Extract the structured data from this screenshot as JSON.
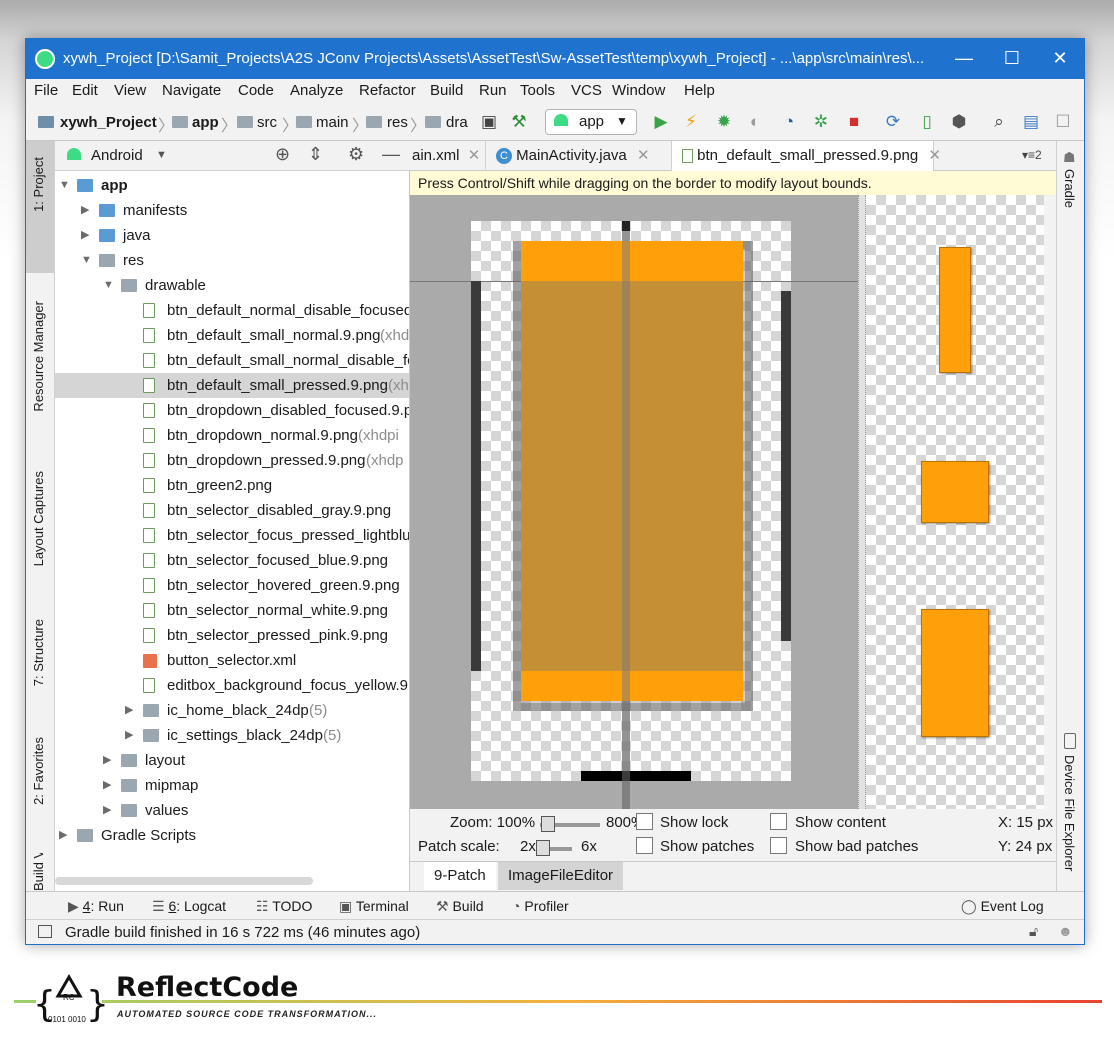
{
  "window": {
    "title": "xywh_Project [D:\\Samit_Projects\\A2S JConv Projects\\Assets\\AssetTest\\Sw-AssetTest\\temp\\xywh_Project] - ...\\app\\src\\main\\res\\...",
    "minimize": "—",
    "maximize": "☐",
    "close": "✕"
  },
  "menu": [
    "File",
    "Edit",
    "View",
    "Navigate",
    "Code",
    "Analyze",
    "Refactor",
    "Build",
    "Run",
    "Tools",
    "VCS",
    "Window",
    "Help"
  ],
  "breadcrumb": [
    "xywh_Project",
    "app",
    "src",
    "main",
    "res",
    "dra"
  ],
  "toolbar": {
    "run_config": "app"
  },
  "left_tools": [
    "1: Project",
    "Resource Manager",
    "Layout Captures",
    "7: Structure",
    "2: Favorites",
    "Build Variants"
  ],
  "right_tools": [
    "Gradle",
    "Device File Explorer"
  ],
  "project": {
    "view": "Android",
    "tree": [
      {
        "label": "app",
        "hint": "",
        "depth": 0,
        "type": "module",
        "arrow": "▼"
      },
      {
        "label": "manifests",
        "hint": "",
        "depth": 1,
        "type": "folder-blue",
        "arrow": "▶"
      },
      {
        "label": "java",
        "hint": "",
        "depth": 1,
        "type": "folder-blue",
        "arrow": "▶"
      },
      {
        "label": "res",
        "hint": "",
        "depth": 1,
        "type": "folder",
        "arrow": "▼"
      },
      {
        "label": "drawable",
        "hint": "",
        "depth": 2,
        "type": "folder",
        "arrow": "▼"
      },
      {
        "label": "btn_default_normal_disable_focused",
        "hint": "",
        "depth": 3,
        "type": "png",
        "arrow": ""
      },
      {
        "label": "btn_default_small_normal.9.png",
        "hint": " (xhd",
        "depth": 3,
        "type": "png",
        "arrow": ""
      },
      {
        "label": "btn_default_small_normal_disable_fo",
        "hint": "",
        "depth": 3,
        "type": "png",
        "arrow": ""
      },
      {
        "label": "btn_default_small_pressed.9.png",
        "hint": " (xh",
        "depth": 3,
        "type": "png",
        "arrow": "",
        "selected": true
      },
      {
        "label": "btn_dropdown_disabled_focused.9.p",
        "hint": "",
        "depth": 3,
        "type": "png",
        "arrow": ""
      },
      {
        "label": "btn_dropdown_normal.9.png",
        "hint": " (xhdpi",
        "depth": 3,
        "type": "png",
        "arrow": ""
      },
      {
        "label": "btn_dropdown_pressed.9.png",
        "hint": " (xhdp",
        "depth": 3,
        "type": "png",
        "arrow": ""
      },
      {
        "label": "btn_green2.png",
        "hint": "",
        "depth": 3,
        "type": "png",
        "arrow": ""
      },
      {
        "label": "btn_selector_disabled_gray.9.png",
        "hint": "",
        "depth": 3,
        "type": "png",
        "arrow": ""
      },
      {
        "label": "btn_selector_focus_pressed_lightblue",
        "hint": "",
        "depth": 3,
        "type": "png",
        "arrow": ""
      },
      {
        "label": "btn_selector_focused_blue.9.png",
        "hint": "",
        "depth": 3,
        "type": "png",
        "arrow": ""
      },
      {
        "label": "btn_selector_hovered_green.9.png",
        "hint": "",
        "depth": 3,
        "type": "png",
        "arrow": ""
      },
      {
        "label": "btn_selector_normal_white.9.png",
        "hint": "",
        "depth": 3,
        "type": "png",
        "arrow": ""
      },
      {
        "label": "btn_selector_pressed_pink.9.png",
        "hint": "",
        "depth": 3,
        "type": "png",
        "arrow": ""
      },
      {
        "label": "button_selector.xml",
        "hint": "",
        "depth": 3,
        "type": "xml",
        "arrow": ""
      },
      {
        "label": "editbox_background_focus_yellow.9",
        "hint": "",
        "depth": 3,
        "type": "png",
        "arrow": ""
      },
      {
        "label": "ic_home_black_24dp",
        "hint": " (5)",
        "depth": 3,
        "type": "folder",
        "arrow": "▶"
      },
      {
        "label": "ic_settings_black_24dp",
        "hint": " (5)",
        "depth": 3,
        "type": "folder",
        "arrow": "▶"
      },
      {
        "label": "layout",
        "hint": "",
        "depth": 2,
        "type": "folder",
        "arrow": "▶"
      },
      {
        "label": "mipmap",
        "hint": "",
        "depth": 2,
        "type": "folder",
        "arrow": "▶"
      },
      {
        "label": "values",
        "hint": "",
        "depth": 2,
        "type": "folder",
        "arrow": "▶"
      },
      {
        "label": "Gradle Scripts",
        "hint": "",
        "depth": 0,
        "type": "gradle",
        "arrow": "▶"
      }
    ]
  },
  "editor_tabs": [
    {
      "label": "ain.xml",
      "active": false,
      "icon": ""
    },
    {
      "label": "MainActivity.java",
      "active": false,
      "icon": "C"
    },
    {
      "label": "btn_default_small_pressed.9.png",
      "active": true,
      "icon": ""
    }
  ],
  "tab_overflow": "▾≡2",
  "notice": "Press Control/Shift while dragging on the border to modify layout bounds.",
  "nine_patch": {
    "zoom_label": "Zoom: 100%",
    "zoom_max": "800%",
    "zoom_level": 0.03,
    "patch_scale_label": "Patch scale:",
    "patch_scale_min": "2x",
    "patch_scale_max": "6x",
    "patch_scale_level": 0.0,
    "show_lock": "Show lock",
    "show_patches": "Show patches",
    "show_content": "Show content",
    "show_bad_patches": "Show bad patches",
    "x_readout": "X: 15 px",
    "y_readout": "Y: 24 px",
    "fill_color": "#ff9f0a"
  },
  "bottom_editor_tabs": [
    "9-Patch",
    "ImageFileEditor"
  ],
  "tool_windows": [
    {
      "num": "4",
      "label": ": Run"
    },
    {
      "num": "6",
      "label": ": Logcat"
    },
    {
      "num": "",
      "label": "TODO"
    },
    {
      "num": "",
      "label": "Terminal"
    },
    {
      "num": "",
      "label": "Build"
    },
    {
      "num": "",
      "label": "Profiler"
    }
  ],
  "event_log": "Event Log",
  "status_text": "Gradle build finished in 16 s 722 ms (46 minutes ago)",
  "branding": {
    "name": "ReflectCode",
    "tagline": "AUTOMATED SOURCE CODE TRANSFORMATION...",
    "mark": "RC",
    "mark_sub": "0101 0010"
  }
}
